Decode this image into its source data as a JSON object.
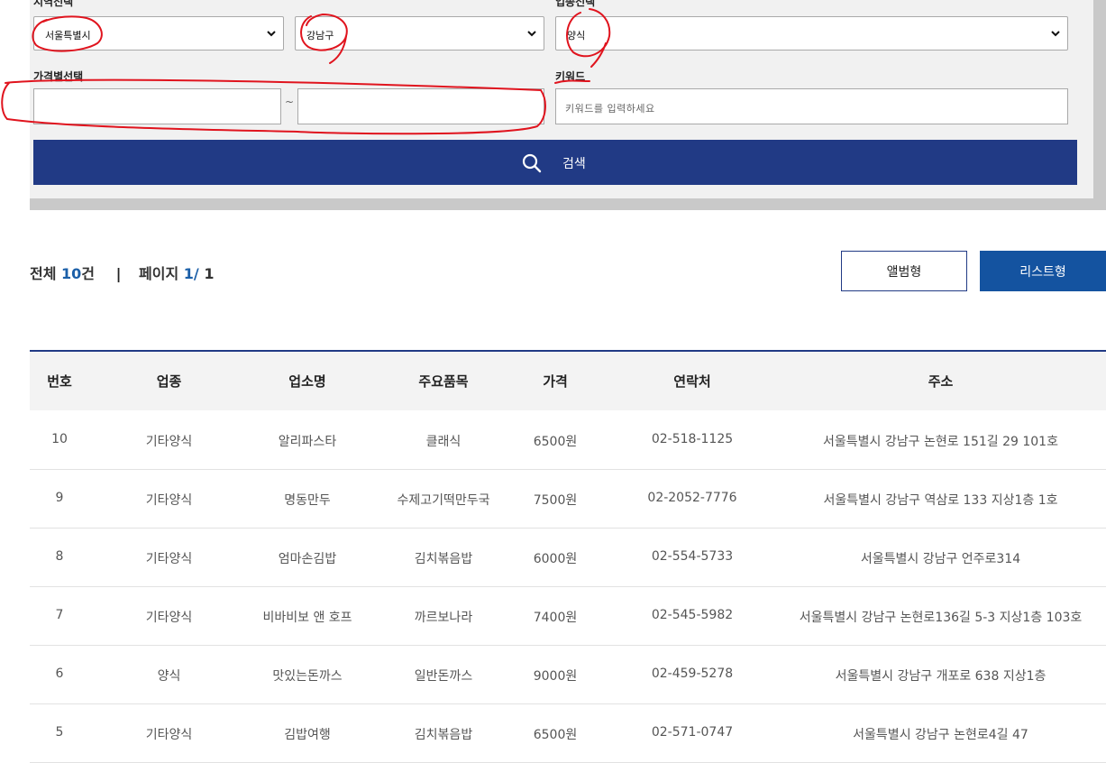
{
  "filters": {
    "region_label": "지역선택",
    "region_value": "서울특별시",
    "district_value": "강남구",
    "category_label": "업종선택",
    "category_value": "양식",
    "price_label": "가격별선택",
    "price_min_value": "",
    "price_max_value": "",
    "price_separator": "~",
    "keyword_label": "키워드",
    "keyword_placeholder": "키워드를 입력하세요",
    "search_button_label": "검색"
  },
  "summary": {
    "total_prefix": "전체",
    "total_count": "10",
    "total_suffix": "건",
    "page_label": "페이지",
    "page_current": "1/",
    "page_total": "1"
  },
  "view_toggle": {
    "album_label": "앨범형",
    "list_label": "리스트형"
  },
  "table": {
    "headers": [
      "번호",
      "업종",
      "업소명",
      "주요품목",
      "가격",
      "연락처",
      "주소"
    ],
    "rows": [
      [
        "10",
        "기타양식",
        "알리파스타",
        "클래식",
        "6500원",
        "02-518-1125",
        "서울특별시 강남구 논현로 151길 29 101호"
      ],
      [
        "9",
        "기타양식",
        "명동만두",
        "수제고기떡만두국",
        "7500원",
        "02-2052-7776",
        "서울특별시 강남구 역삼로 133 지상1층 1호"
      ],
      [
        "8",
        "기타양식",
        "엄마손김밥",
        "김치볶음밥",
        "6000원",
        "02-554-5733",
        "서울특별시 강남구 언주로314"
      ],
      [
        "7",
        "기타양식",
        "비바비보 앤 호프",
        "까르보나라",
        "7400원",
        "02-545-5982",
        "서울특별시 강남구 논현로136길 5-3 지상1층 103호"
      ],
      [
        "6",
        "양식",
        "맛있는돈까스",
        "일반돈까스",
        "9000원",
        "02-459-5278",
        "서울특별시 강남구 개포로 638 지상1층"
      ],
      [
        "5",
        "기타양식",
        "김밥여행",
        "김치볶음밥",
        "6500원",
        "02-571-0747",
        "서울특별시 강남구 논현로4길 47"
      ]
    ]
  },
  "colors": {
    "primary": "#213a85",
    "list_button": "#1453a0",
    "count_highlight": "#1b5fa8",
    "annotation": "#e0141e"
  }
}
